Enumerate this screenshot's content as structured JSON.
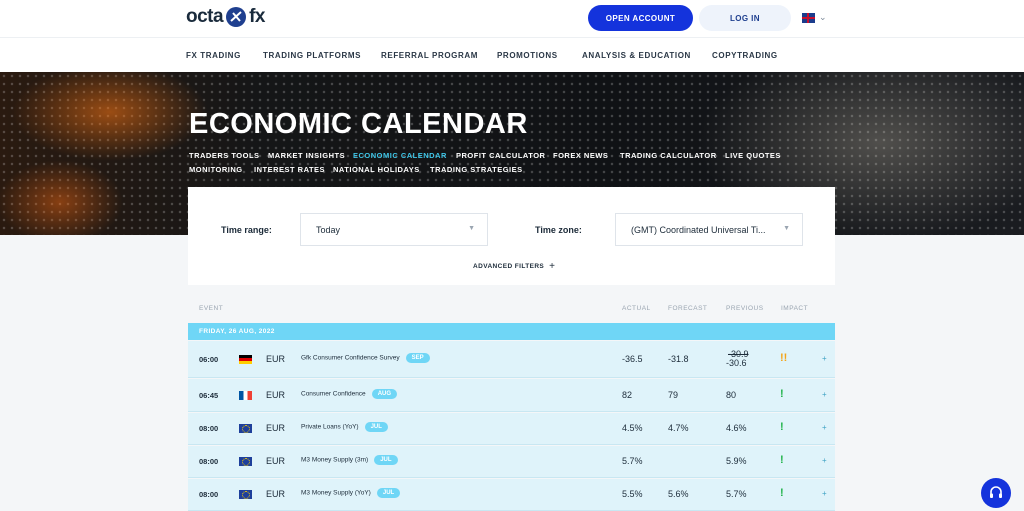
{
  "header": {
    "logo_left": "octa",
    "logo_right": "fx",
    "open_account": "OPEN ACCOUNT",
    "login": "LOG IN",
    "language_icon": "uk-flag-icon"
  },
  "nav": [
    "FX TRADING",
    "TRADING PLATFORMS",
    "REFERRAL PROGRAM",
    "PROMOTIONS",
    "ANALYSIS & EDUCATION",
    "COPYTRADING"
  ],
  "hero": {
    "title": "ECONOMIC CALENDAR",
    "links_row1": [
      "TRADERS TOOLS",
      "MARKET INSIGHTS",
      "ECONOMIC CALENDAR",
      "PROFIT CALCULATOR",
      "FOREX NEWS",
      "TRADING CALCULATOR",
      "LIVE QUOTES"
    ],
    "links_row2": [
      "MONITORING",
      "INTEREST RATES",
      "NATIONAL HOLIDAYS",
      "TRADING STRATEGIES"
    ],
    "active_link": "ECONOMIC CALENDAR"
  },
  "filters": {
    "time_range_label": "Time range:",
    "time_range_value": "Today",
    "time_zone_label": "Time zone:",
    "time_zone_value": "(GMT) Coordinated Universal Ti...",
    "advanced": "ADVANCED FILTERS",
    "advanced_icon": "+"
  },
  "table": {
    "headers": {
      "event": "EVENT",
      "actual": "ACTUAL",
      "forecast": "FORECAST",
      "previous": "PREVIOUS",
      "impact": "IMPACT"
    },
    "date": "FRIDAY, 26 AUG, 2022",
    "rows": [
      {
        "time": "06:00",
        "flag": "DE",
        "currency": "EUR",
        "event": "Gfk Consumer Confidence Survey",
        "period": "SEP",
        "actual": "-36.5",
        "forecast": "-31.8",
        "previous_revised": "-30.9",
        "previous": "-30.6",
        "impact": "!!"
      },
      {
        "time": "06:45",
        "flag": "FR",
        "currency": "EUR",
        "event": "Consumer Confidence",
        "period": "AUG",
        "actual": "82",
        "forecast": "79",
        "previous_revised": "",
        "previous": "80",
        "impact": "!"
      },
      {
        "time": "08:00",
        "flag": "EU",
        "currency": "EUR",
        "event": "Private Loans (YoY)",
        "period": "JUL",
        "actual": "4.5%",
        "forecast": "4.7%",
        "previous_revised": "",
        "previous": "4.6%",
        "impact": "!"
      },
      {
        "time": "08:00",
        "flag": "EU",
        "currency": "EUR",
        "event": "M3 Money Supply (3m)",
        "period": "JUL",
        "actual": "5.7%",
        "forecast": "",
        "previous_revised": "",
        "previous": "5.9%",
        "impact": "!"
      },
      {
        "time": "08:00",
        "flag": "EU",
        "currency": "EUR",
        "event": "M3 Money Supply (YoY)",
        "period": "JUL",
        "actual": "5.5%",
        "forecast": "5.6%",
        "previous_revised": "",
        "previous": "5.7%",
        "impact": "!"
      }
    ],
    "expand_icon": "+"
  },
  "colors": {
    "primary": "#1433dc",
    "accent": "#6fd6f6",
    "row_bg": "#dff3fa",
    "impact_high": "#f3a51b",
    "impact_low": "#21b34a"
  }
}
